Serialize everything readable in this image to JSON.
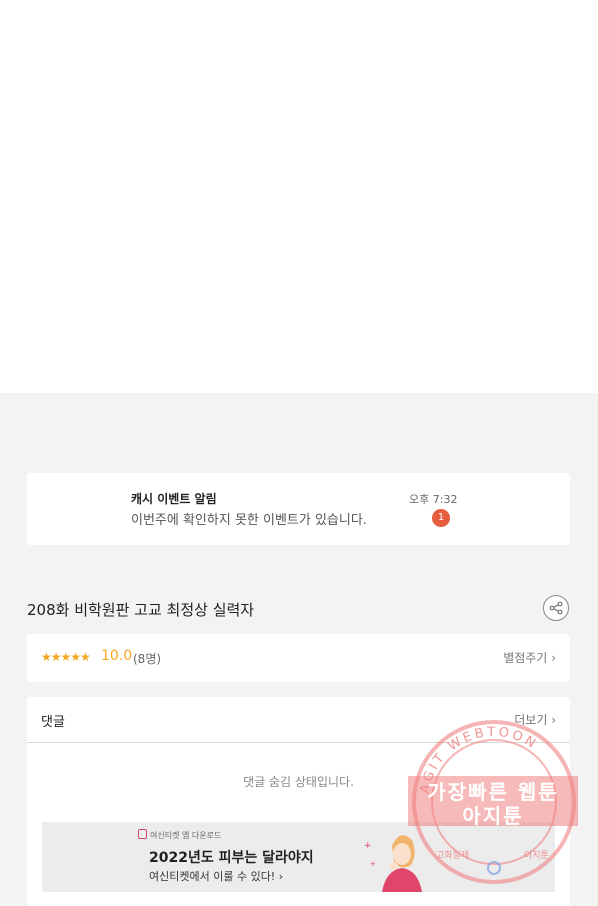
{
  "notification": {
    "title": "캐시 이벤트 알림",
    "message": "이번주에 확인하지 못한 이벤트가 있습니다.",
    "time": "오후 7:32",
    "badge_count": "1"
  },
  "episode": {
    "title": "208화 비학원판 고교 최정상 실력자"
  },
  "rating": {
    "stars": "★★★★★",
    "score": "10.0",
    "count": "(8명)",
    "rate_button": "별점주기"
  },
  "comments": {
    "label": "댓글",
    "more_button": "더보기",
    "hidden_message": "댓글 숨김 상태입니다."
  },
  "ad": {
    "brand": "여신티켓 앱 다운로드",
    "headline": "2022년도 피부는 달라야지",
    "subtext": "여신티켓에서 이룰 수 있다!"
  },
  "watermark": {
    "ring_text": "AGIT WEBTOON",
    "line1": "가장빠른 웹툰",
    "line2": "아지툰",
    "bottom_left": "고화질제",
    "bottom_right": "아지툰"
  },
  "colors": {
    "accent_orange": "#f5a623",
    "badge_red": "#e65c3c",
    "watermark_pink": "#f08282"
  },
  "icons": {
    "share": "share-icon",
    "chevron": "chevron-right-icon"
  }
}
